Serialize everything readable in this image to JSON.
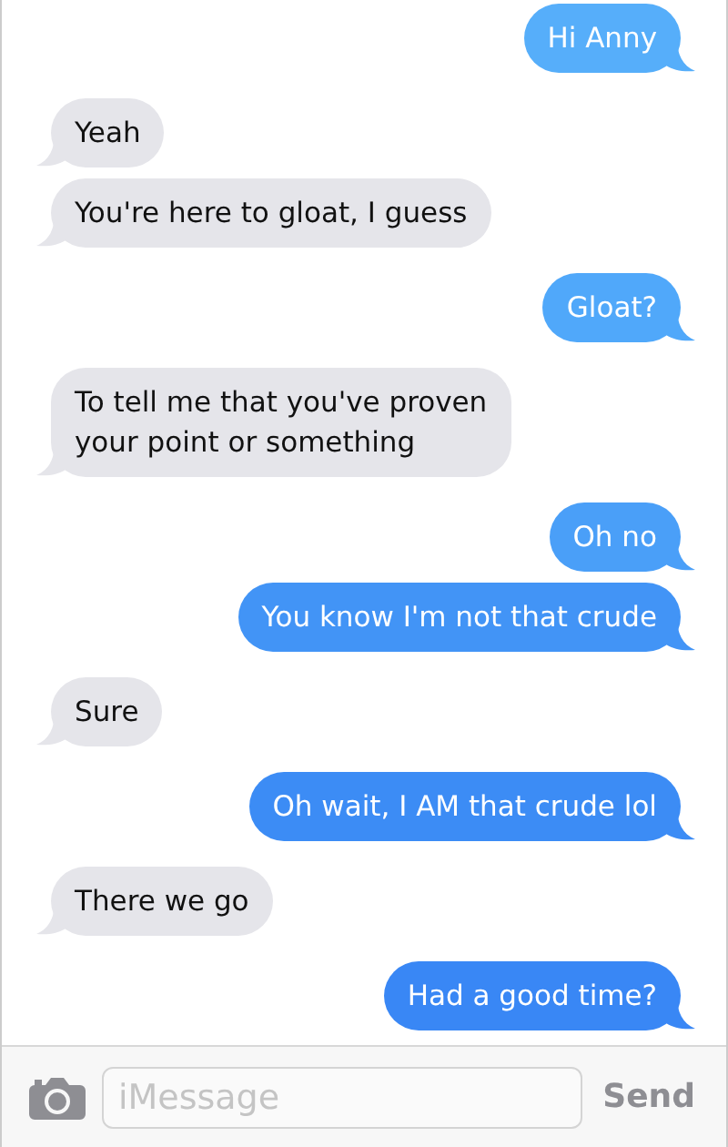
{
  "messages": [
    {
      "text": "Hi Anny",
      "kind": "sent",
      "color": "#56aefa"
    },
    {
      "text": "Yeah",
      "kind": "received",
      "color": "#e5e5ea"
    },
    {
      "text": "You're here to gloat, I guess",
      "kind": "received",
      "color": "#e5e5ea"
    },
    {
      "text": "Gloat?",
      "kind": "sent",
      "color": "#50a8fa"
    },
    {
      "text": "To tell me that you've proven\nyour point or something",
      "kind": "received",
      "color": "#e5e5ea"
    },
    {
      "text": "Oh no",
      "kind": "sent",
      "color": "#4a9ff8"
    },
    {
      "text": "You know I'm not that crude",
      "kind": "sent",
      "color": "#4294f6"
    },
    {
      "text": "Sure",
      "kind": "received",
      "color": "#e5e5ea"
    },
    {
      "text": "Oh wait, I AM that crude lol",
      "kind": "sent",
      "color": "#3c8cf5"
    },
    {
      "text": "There we go",
      "kind": "received",
      "color": "#e5e5ea"
    },
    {
      "text": "Had a good time?",
      "kind": "sent",
      "color": "#3987f5"
    }
  ],
  "compose": {
    "placeholder": "iMessage",
    "send": "Send"
  }
}
